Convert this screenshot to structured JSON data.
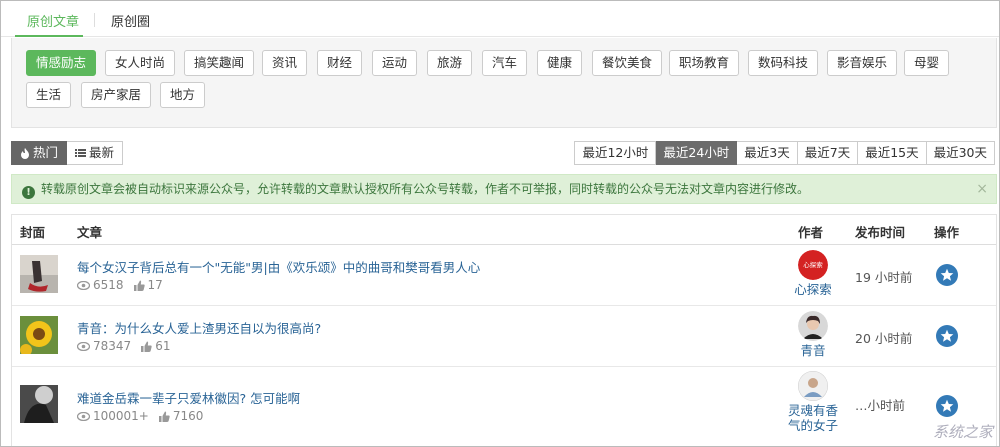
{
  "tabs": [
    {
      "label": "原创文章",
      "active": true
    },
    {
      "label": "原创圈",
      "active": false
    }
  ],
  "categories": [
    "情感励志",
    "女人时尚",
    "搞笑趣闻",
    "资讯",
    "财经",
    "运动",
    "旅游",
    "汽车",
    "健康",
    "餐饮美食",
    "职场教育",
    "数码科技",
    "影音娱乐",
    "母婴",
    "生活",
    "房产家居",
    "地方"
  ],
  "active_category": "情感励志",
  "sort": {
    "hot_label": "热门",
    "new_label": "最新",
    "active": "热门"
  },
  "time_filters": [
    "最近12小时",
    "最近24小时",
    "最近3天",
    "最近7天",
    "最近15天",
    "最近30天"
  ],
  "active_time_filter": "最近24小时",
  "alert": {
    "text": "转载原创文章会被自动标识来源公众号，允许转载的文章默认授权所有公众号转载，作者不可举报，同时转载的公众号无法对文章内容进行修改。",
    "close": "×"
  },
  "table": {
    "headers": {
      "cover": "封面",
      "article": "文章",
      "author": "作者",
      "time": "发布时间",
      "op": "操作"
    },
    "rows": [
      {
        "title": "每个女汉子背后总有一个\"无能\"男|由《欢乐颂》中的曲哥和樊哥看男人心",
        "views": "6518",
        "likes": "17",
        "author": "心探索",
        "time": "19 小时前",
        "avatar_text": "心探索"
      },
      {
        "title": "青音：为什么女人爱上渣男还自以为很高尚?",
        "views": "78347",
        "likes": "61",
        "author": "青音",
        "time": "20 小时前",
        "avatar_text": ""
      },
      {
        "title": "难道金岳霖一辈子只爱林徽因? 怎可能啊",
        "views": "100001+",
        "likes": "7160",
        "author": "灵魂有香气的女子",
        "time": "…小时前",
        "avatar_text": ""
      }
    ]
  },
  "watermark": "系统之家",
  "colors": {
    "accent": "#5cb85c",
    "link": "#2a6496",
    "op": "#337ab7"
  }
}
